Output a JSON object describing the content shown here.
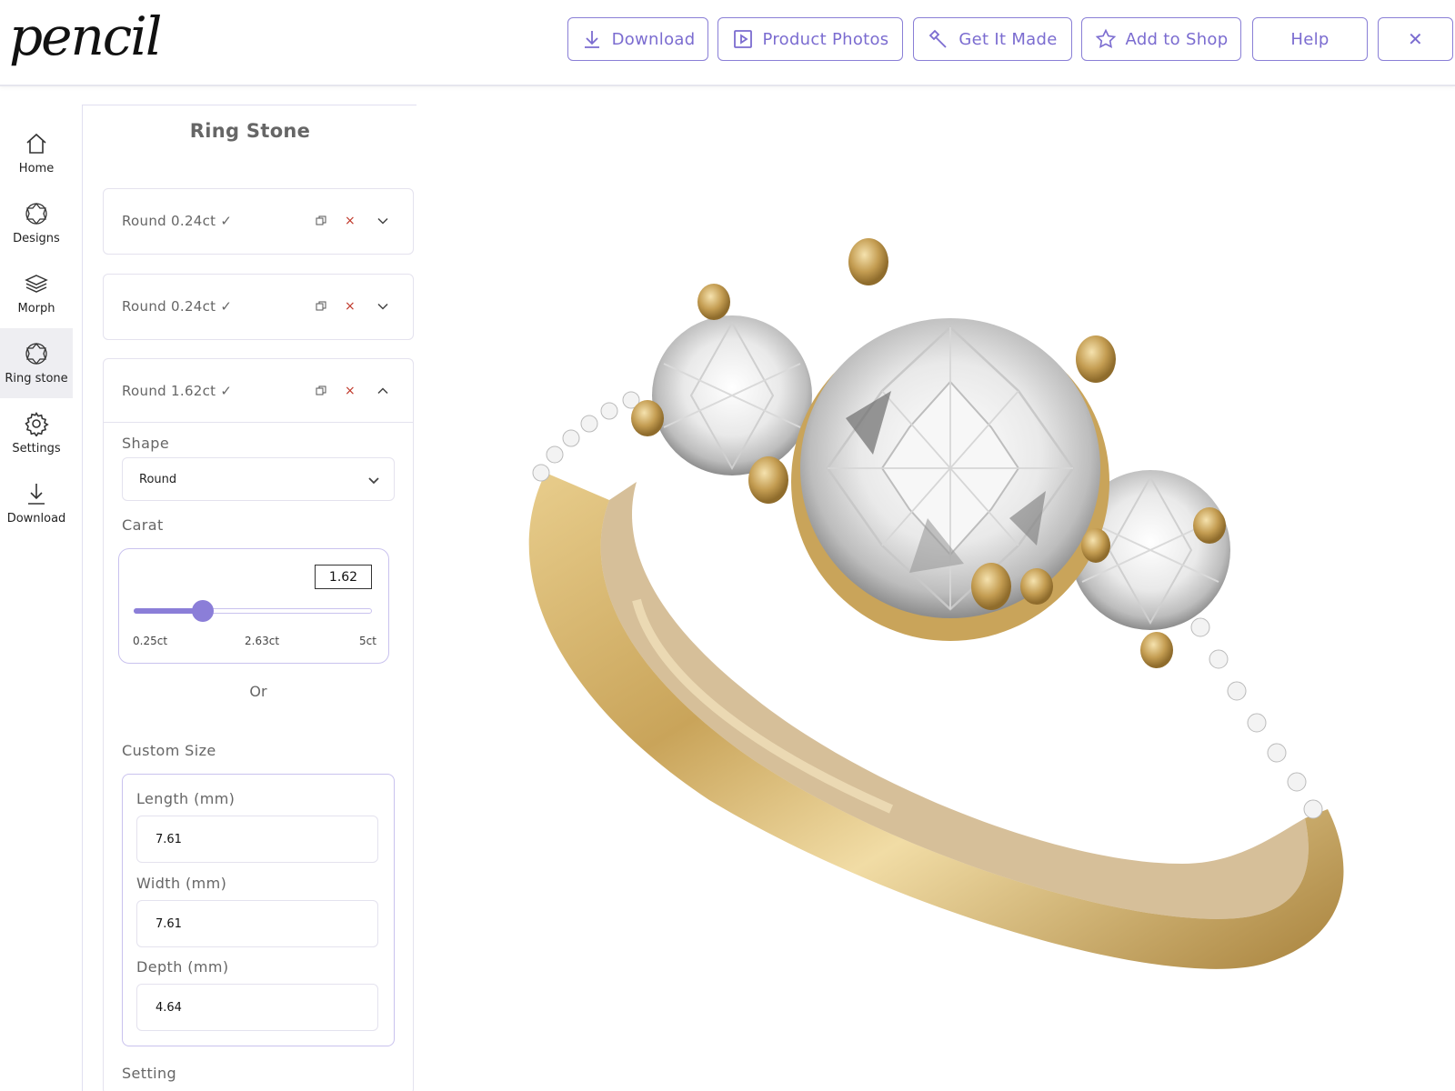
{
  "brand": {
    "logo_text": "pencil"
  },
  "toolbar": {
    "download_label": "Download",
    "photos_label": "Product Photos",
    "made_label": "Get It Made",
    "shop_label": "Add to Shop",
    "help_label": "Help",
    "close_glyph": "✕"
  },
  "nav": {
    "items": [
      {
        "label": "Home",
        "icon": "home-icon"
      },
      {
        "label": "Designs",
        "icon": "gem-icon"
      },
      {
        "label": "Morph",
        "icon": "layers-icon"
      },
      {
        "label": "Ring stone",
        "icon": "gem-icon",
        "active": true
      },
      {
        "label": "Settings",
        "icon": "gear-icon"
      },
      {
        "label": "Download",
        "icon": "download-icon"
      }
    ]
  },
  "panel": {
    "title": "Ring Stone",
    "stones": [
      {
        "label": "Round 0.24ct ✓",
        "expanded": false
      },
      {
        "label": "Round 0.24ct ✓",
        "expanded": false
      },
      {
        "label": "Round 1.62ct ✓",
        "expanded": true
      }
    ],
    "delete_glyph": "×",
    "shape": {
      "label": "Shape",
      "value": "Round"
    },
    "carat": {
      "label": "Carat",
      "value": "1.62",
      "min_label": "0.25ct",
      "mid_label": "2.63ct",
      "max_label": "5ct",
      "min": 0.25,
      "max": 5,
      "current": 1.62
    },
    "or_text": "Or",
    "custom_size": {
      "label": "Custom Size",
      "length_label": "Length (mm)",
      "length_value": "7.61",
      "width_label": "Width (mm)",
      "width_value": "7.61",
      "depth_label": "Depth (mm)",
      "depth_value": "4.64"
    },
    "setting_label": "Setting"
  },
  "colors": {
    "accent": "#7b6cd0",
    "slider": "#8b7ed8",
    "gold": "#c9a45a",
    "delete": "#c0392b"
  }
}
